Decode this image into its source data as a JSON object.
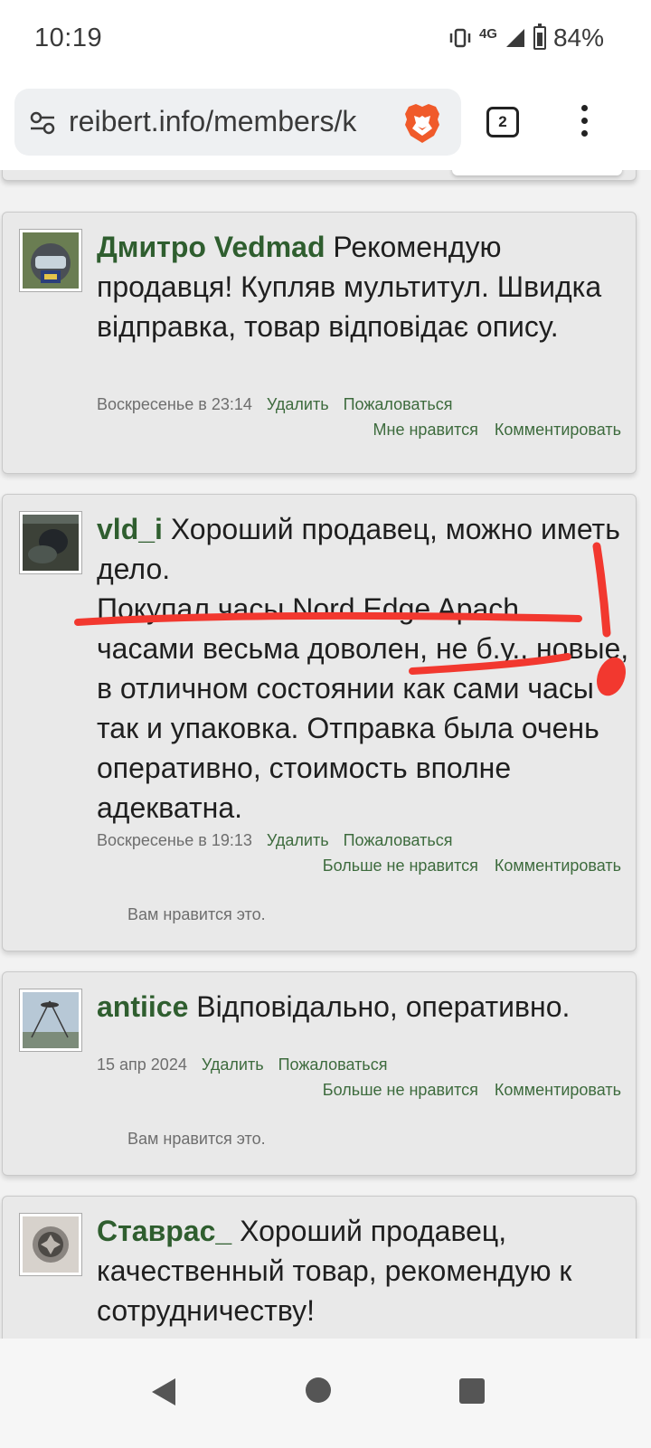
{
  "status_bar": {
    "time": "10:19",
    "network": "4G",
    "battery": "84%"
  },
  "browser": {
    "url": "reibert.info/members/k",
    "tab_count": "2"
  },
  "comments": [
    {
      "author": "Дмитро Vedmad",
      "text": " Рекомендую продавця! Купляв мультитул. Швидка відправка, товар відповідає опису.",
      "time": "Воскресенье в 23:14",
      "delete": "Удалить",
      "report": "Пожаловаться",
      "like": "Мне нравится",
      "comment": "Комментировать"
    },
    {
      "author": "vld_i",
      "text_line1": " Хороший продавец, можно иметь дело.",
      "text_line2": "Покупал часы Nord Edge Apach. часами весьма доволен, не б.у., новые, в отличном состоянии как сами часы так и упаковка. Отправка была очень оперативно, стоимость вполне адекватна.",
      "time": "Воскресенье в 19:13",
      "delete": "Удалить",
      "report": "Пожаловаться",
      "like": "Больше не нравится",
      "comment": "Комментировать",
      "like_note": "Вам нравится это."
    },
    {
      "author": "antiice",
      "text": " Відповідально, оперативно.",
      "time": "15 апр 2024",
      "delete": "Удалить",
      "report": "Пожаловаться",
      "like": "Больше не нравится",
      "comment": "Комментировать",
      "like_note": "Вам нравится это."
    },
    {
      "author": "Ставрас_",
      "text": " Хороший продавец, качественный товар, рекомендую к сотрудничеству!"
    }
  ],
  "annotation": {
    "color": "#f2382f"
  }
}
